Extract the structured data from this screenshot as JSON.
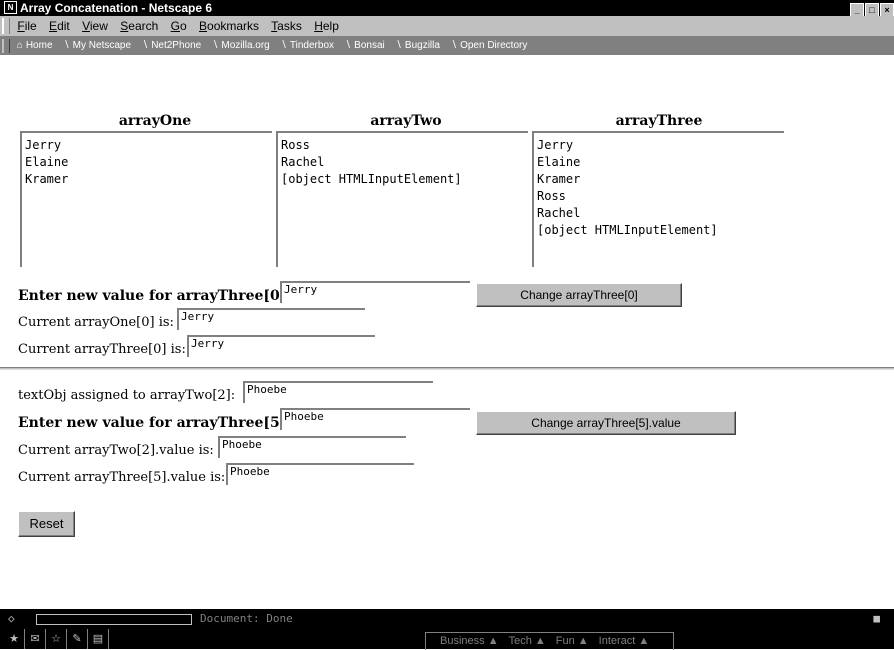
{
  "window": {
    "title": "Array Concatenation - Netscape 6",
    "buttons": [
      "_",
      "□",
      "×"
    ]
  },
  "menubar": {
    "items": [
      {
        "u": "F",
        "rest": "ile"
      },
      {
        "u": "E",
        "rest": "dit"
      },
      {
        "u": "V",
        "rest": "iew"
      },
      {
        "u": "S",
        "rest": "earch"
      },
      {
        "u": "G",
        "rest": "o"
      },
      {
        "u": "B",
        "rest": "ookmarks"
      },
      {
        "u": "T",
        "rest": "asks"
      },
      {
        "u": "H",
        "rest": "elp"
      }
    ]
  },
  "personal_toolbar": {
    "items": [
      "Home",
      "My Netscape",
      "Net2Phone",
      "Mozilla.org",
      "Tinderbox",
      "Bonsai",
      "Bugzilla",
      "Open Directory"
    ]
  },
  "arrays": {
    "one": {
      "heading": "arrayOne",
      "text": "Jerry\nElaine\nKramer"
    },
    "two": {
      "heading": "arrayTwo",
      "text": "Ross\nRachel\n[object HTMLInputElement]"
    },
    "three": {
      "heading": "arrayThree",
      "text": "Jerry\nElaine\nKramer\nRoss\nRachel\n[object HTMLInputElement]"
    }
  },
  "section1": {
    "enter_label": "Enter new value for arrayThree[0]:",
    "enter_value": "Jerry",
    "change_button": "Change arrayThree[0]",
    "current_one_label": "Current arrayOne[0] is:",
    "current_one_value": "Jerry",
    "current_three_label": "Current arrayThree[0] is:",
    "current_three_value": "Jerry"
  },
  "section2": {
    "textobj_label": "textObj assigned to arrayTwo[2]:",
    "textobj_value": "Phoebe",
    "enter_label": "Enter new value for arrayThree[5]:",
    "enter_value": "Phoebe",
    "change_button": "Change arrayThree[5].value",
    "current_two_label": "Current arrayTwo[2].value is:",
    "current_two_value": "Phoebe",
    "current_three_label": "Current arrayThree[5].value is:",
    "current_three_value": "Phoebe",
    "reset_button": "Reset"
  },
  "status": {
    "text": "Document: Done"
  },
  "taskbar": {
    "tabs": [
      "Business ▲",
      "Tech ▲",
      "Fun ▲",
      "Interact ▲"
    ]
  }
}
